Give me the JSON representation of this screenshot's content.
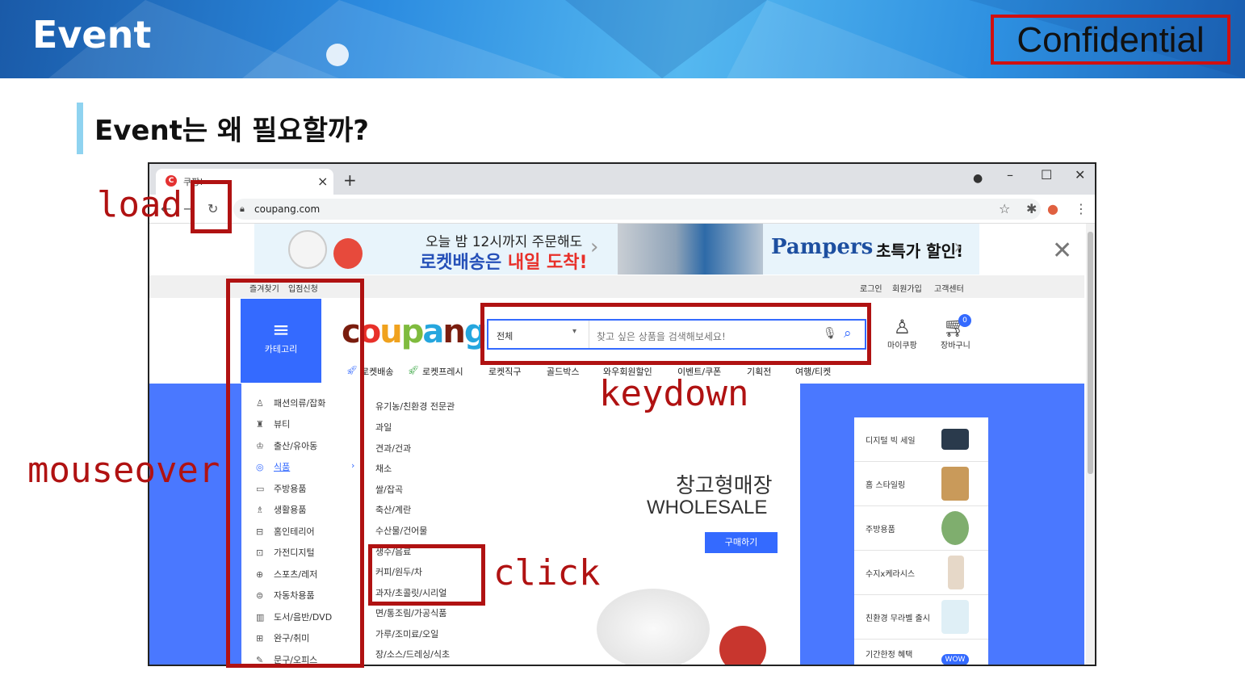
{
  "slide": {
    "title": "Event",
    "confidential": "Confidential",
    "heading": "Event는 왜 필요할까?"
  },
  "browser": {
    "tab_title": "쿠팡!",
    "tab_favicon": "C",
    "url": "coupang.com"
  },
  "banner": {
    "line1": "오늘 밤 12시까지 주문해도",
    "line2_a": "로켓배송은 ",
    "line2_b": "내일 도착!",
    "brand": "Pampers",
    "sale": "초특가 할인!"
  },
  "header": {
    "links_left": [
      "즐겨찾기",
      "입점신청"
    ],
    "links_right": [
      "로그인",
      "회원가입",
      "고객센터"
    ],
    "category_label": "카테고리",
    "logo": "coupang",
    "search_scope": "전체",
    "search_placeholder": "찾고 싶은 상품을 검색해보세요!",
    "mypage": "마이쿠팡",
    "cart": "장바구니",
    "cart_count": "0",
    "subnav": [
      "로켓배송",
      "로켓프레시",
      "로켓직구",
      "골드박스",
      "와우회원할인",
      "이벤트/쿠폰",
      "기획전",
      "여행/티켓"
    ]
  },
  "categories": [
    "패션의류/잡화",
    "뷰티",
    "출산/유아동",
    "식품",
    "주방용품",
    "생활용품",
    "홈인테리어",
    "가전디지털",
    "스포츠/레저",
    "자동차용품",
    "도서/음반/DVD",
    "완구/취미",
    "문구/오피스"
  ],
  "subcategories": [
    "유기농/친환경 전문관",
    "과일",
    "견과/건과",
    "채소",
    "쌀/잡곡",
    "축산/계란",
    "수산물/건어물",
    "생수/음료",
    "커피/원두/차",
    "과자/초콜릿/시리얼",
    "면/통조림/가공식품",
    "가루/조미료/오일",
    "장/소스/드레싱/식초"
  ],
  "promo": {
    "title": "창고형매장",
    "subtitle": "WHOLESALE",
    "button": "구매하기"
  },
  "side_cards": [
    "디지털 빅 세일",
    "홈 스타일링",
    "주방용품",
    "수지x케라시스",
    "친환경 무라벨 출시",
    "기간한정 혜택"
  ],
  "side_badge": "WOW",
  "annotations": {
    "load": "load",
    "keydown": "keydown",
    "mouseover": "mouseover",
    "click": "click"
  },
  "colors": {
    "annotation_red": "#b01212",
    "coupang_blue": "#346aff",
    "confidential_border": "#d01010"
  }
}
